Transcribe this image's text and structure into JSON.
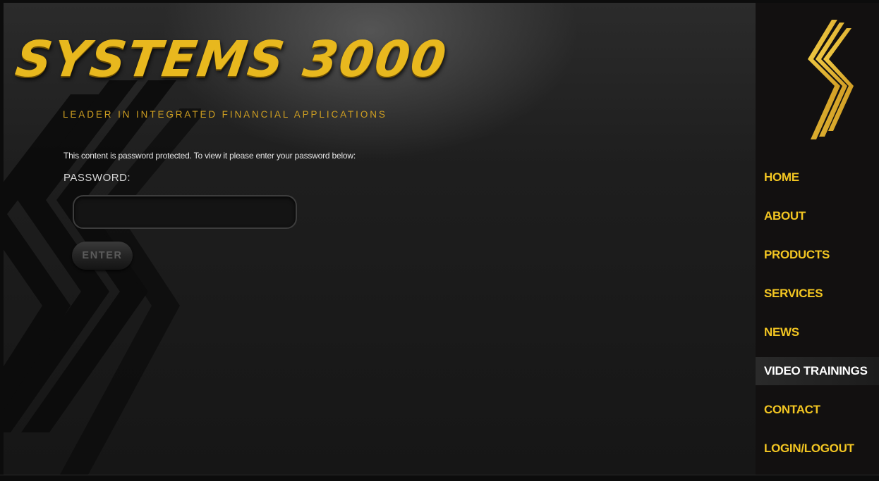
{
  "header": {
    "logo_text": "SYSTEMS 3000",
    "tagline": "LEADER IN INTEGRATED FINANCIAL APPLICATIONS"
  },
  "form": {
    "message": "This content is password protected. To view it please enter your password below:",
    "password_label": "PASSWORD:",
    "password_value": "",
    "enter_label": "ENTER"
  },
  "nav": {
    "items": [
      {
        "label": "HOME",
        "active": false
      },
      {
        "label": "ABOUT",
        "active": false
      },
      {
        "label": "PRODUCTS",
        "active": false
      },
      {
        "label": "SERVICES",
        "active": false
      },
      {
        "label": "NEWS",
        "active": false
      },
      {
        "label": "VIDEO TRAININGS",
        "active": true
      },
      {
        "label": "CONTACT",
        "active": false
      },
      {
        "label": "LOGIN/LOGOUT",
        "active": false
      }
    ]
  },
  "colors": {
    "brand_gold": "#e8b81e",
    "nav_text": "#f3c622",
    "nav_active_text": "#ffffff",
    "background": "#1e1e1e"
  }
}
